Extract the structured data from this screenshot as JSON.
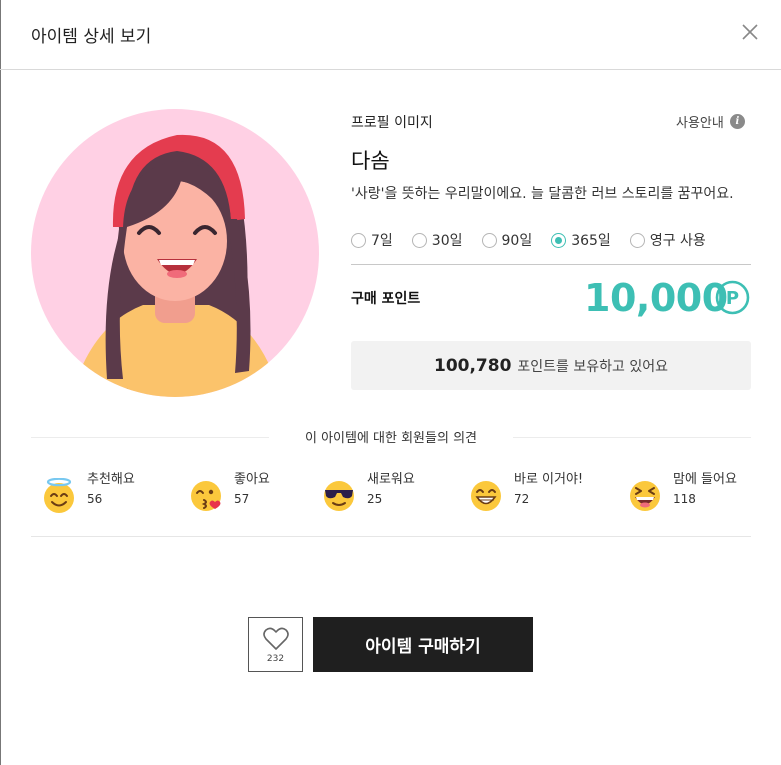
{
  "header": {
    "title": "아이템 상세 보기"
  },
  "item": {
    "category": "프로필 이미지",
    "guide_label": "사용안내",
    "name": "다솜",
    "description": "'사랑'을 뜻하는 우리말이에요. 늘 달콤한 러브 스토리를 꿈꾸어요."
  },
  "durations": [
    {
      "label": "7일",
      "selected": false
    },
    {
      "label": "30일",
      "selected": false
    },
    {
      "label": "90일",
      "selected": false
    },
    {
      "label": "365일",
      "selected": true
    },
    {
      "label": "영구 사용",
      "selected": false
    }
  ],
  "price": {
    "label": "구매 포인트",
    "value": "10,000",
    "unit_symbol": "P"
  },
  "balance": {
    "value": "100,780",
    "text": "포인트를 보유하고 있어요"
  },
  "opinions": {
    "title": "이 아이템에 대한 회원들의 의견",
    "reactions": [
      {
        "label": "추천해요",
        "count": "56",
        "icon": "halo-smile-emoji-icon"
      },
      {
        "label": "좋아요",
        "count": "57",
        "icon": "kiss-emoji-icon"
      },
      {
        "label": "새로워요",
        "count": "25",
        "icon": "sunglasses-emoji-icon"
      },
      {
        "label": "바로 이거야!",
        "count": "72",
        "icon": "grin-emoji-icon"
      },
      {
        "label": "맘에 들어요",
        "count": "118",
        "icon": "laughing-emoji-icon"
      }
    ]
  },
  "actions": {
    "like_count": "232",
    "buy_label": "아이템 구매하기"
  },
  "colors": {
    "accent": "#3dbfb4",
    "buy_button": "#1f1f1f",
    "avatar_bg": "#ffd0e4"
  }
}
